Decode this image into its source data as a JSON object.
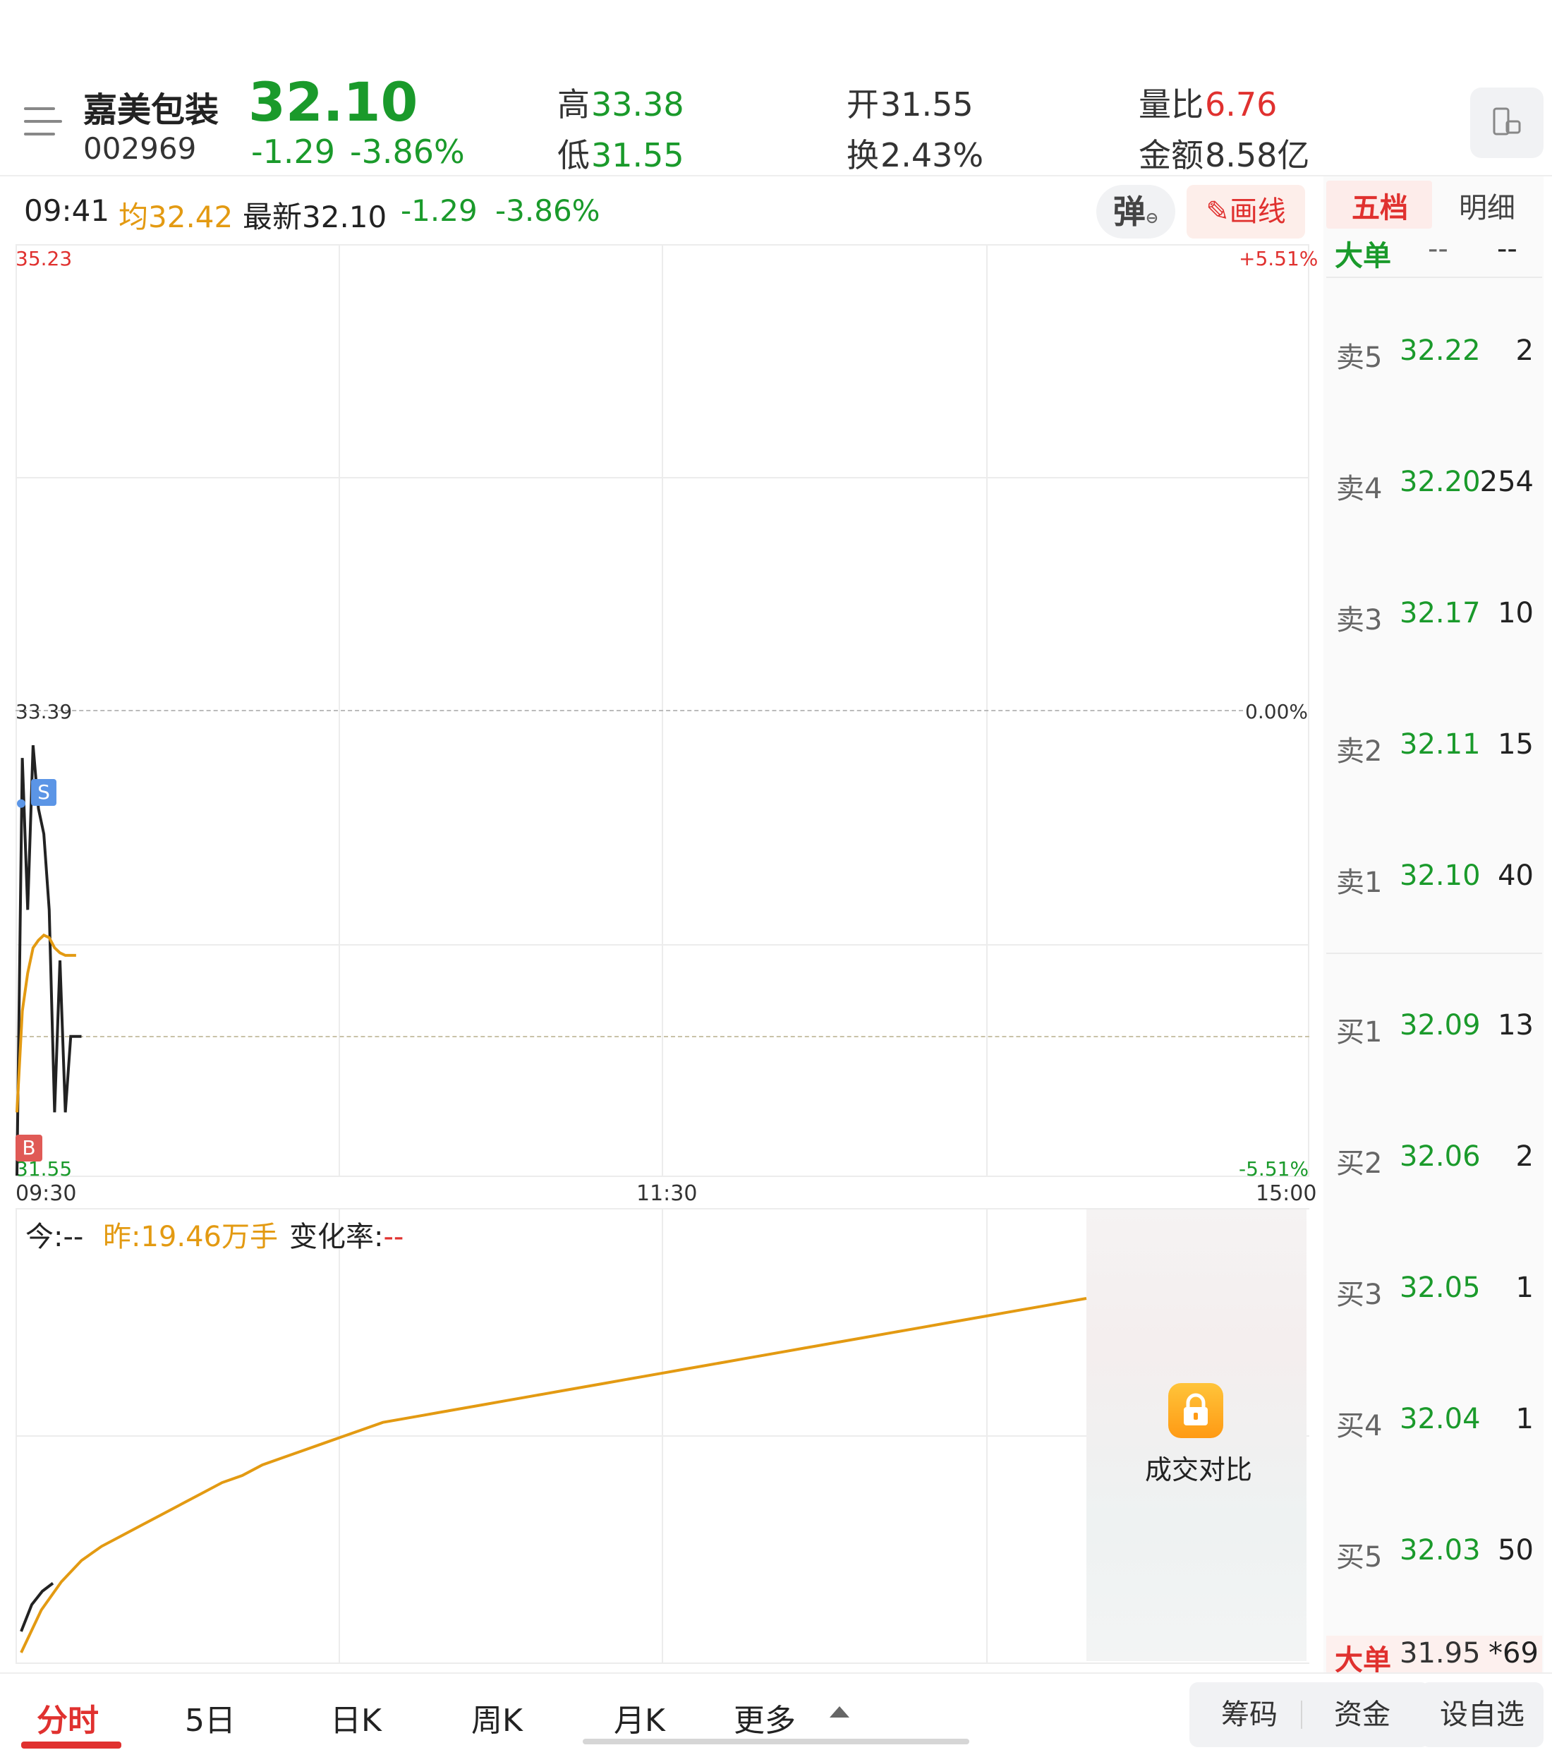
{
  "header": {
    "stock_name": "嘉美包装",
    "stock_code": "002969",
    "price": "32.10",
    "change": "-1.29",
    "change_pct": "-3.86%",
    "high_label": "高",
    "high": "33.38",
    "low_label": "低",
    "low": "31.55",
    "open_label": "开",
    "open": "31.55",
    "turnover_label": "换",
    "turnover": "2.43%",
    "vol_ratio_label": "量比",
    "vol_ratio": "6.76",
    "amount_label": "金额",
    "amount": "8.58亿"
  },
  "info_bar": {
    "time": "09:41",
    "avg_label": "均",
    "avg": "32.42",
    "latest_label": "最新",
    "latest": "32.10",
    "change": "-1.29",
    "change_pct": "-3.86%",
    "popup_label": "弹",
    "draw_label": "画线"
  },
  "chart_data": {
    "type": "line",
    "title": "",
    "y_price_ticks": [
      "35.23",
      "33.39",
      "31.55"
    ],
    "y_pct_ticks": [
      "+5.51%",
      "0.00%",
      "-5.51%"
    ],
    "x_ticks": [
      "09:30",
      "11:30",
      "15:00"
    ],
    "ylim": [
      31.55,
      35.23
    ],
    "prev_close": 33.39,
    "markers": [
      {
        "label": "S",
        "color": "#5b95e6"
      },
      {
        "label": "B",
        "color": "#e05a56"
      }
    ],
    "series": [
      {
        "color": "#222222",
        "x": [
          0,
          1,
          2,
          3,
          4,
          5,
          6,
          7,
          8,
          9,
          10,
          11,
          12
        ],
        "values": [
          31.55,
          33.2,
          32.6,
          33.25,
          33.0,
          32.9,
          32.6,
          31.8,
          32.4,
          31.8,
          32.1,
          32.1,
          32.1
        ]
      },
      {
        "color": "#e39a12",
        "x": [
          0,
          1,
          2,
          3,
          4,
          5,
          6,
          7,
          8,
          9,
          10,
          11
        ],
        "values": [
          31.8,
          32.2,
          32.35,
          32.45,
          32.48,
          32.5,
          32.49,
          32.45,
          32.43,
          32.42,
          32.42,
          32.42
        ]
      }
    ],
    "xlim": [
      0,
      240
    ]
  },
  "volume": {
    "today_label": "今:",
    "today": "--",
    "yesterday_label": "昨:",
    "yesterday": "19.46万手",
    "change_label": "变化率:",
    "change": "--",
    "locked_label": "成交对比",
    "yesterday_curve": [
      0.0,
      0.12,
      0.2,
      0.26,
      0.3,
      0.33,
      0.36,
      0.39,
      0.42,
      0.45,
      0.48,
      0.5,
      0.53,
      0.55,
      0.57,
      0.59,
      0.61,
      0.63,
      0.65,
      0.66,
      0.67,
      0.68,
      0.69,
      0.7,
      0.71,
      0.72,
      0.73,
      0.74,
      0.75,
      0.76,
      0.77,
      0.78,
      0.79,
      0.8,
      0.81,
      0.82,
      0.83,
      0.84,
      0.85,
      0.86,
      0.87,
      0.88,
      0.89,
      0.9,
      0.91,
      0.92,
      0.93,
      0.94,
      0.95,
      0.96,
      0.97,
      0.98,
      0.99,
      1.0
    ],
    "today_curve": [
      0.0,
      0.2,
      0.3,
      0.36
    ]
  },
  "order_book": {
    "tab_active": "五档",
    "tab_inactive": "明细",
    "big_order_label": "大单",
    "big_order_top": [
      "--",
      "--"
    ],
    "asks": [
      {
        "label": "卖5",
        "price": "32.22",
        "qty": "2"
      },
      {
        "label": "卖4",
        "price": "32.20",
        "qty": "254"
      },
      {
        "label": "卖3",
        "price": "32.17",
        "qty": "10"
      },
      {
        "label": "卖2",
        "price": "32.11",
        "qty": "15"
      },
      {
        "label": "卖1",
        "price": "32.10",
        "qty": "40"
      }
    ],
    "bids": [
      {
        "label": "买1",
        "price": "32.09",
        "qty": "13"
      },
      {
        "label": "买2",
        "price": "32.06",
        "qty": "2"
      },
      {
        "label": "买3",
        "price": "32.05",
        "qty": "1"
      },
      {
        "label": "买4",
        "price": "32.04",
        "qty": "1"
      },
      {
        "label": "买5",
        "price": "32.03",
        "qty": "50"
      }
    ],
    "big_order_bottom_label": "大单",
    "big_order_bottom_price": "31.95",
    "big_order_bottom_qty": "*69"
  },
  "bottom_tabs": [
    "分时",
    "5日",
    "日K",
    "周K",
    "月K",
    "更多"
  ],
  "bottom_buttons": [
    "筹码",
    "资金",
    "设自选"
  ],
  "colors": {
    "up": "#e0312f",
    "down": "#1a9a2b",
    "avg": "#e39a12"
  }
}
